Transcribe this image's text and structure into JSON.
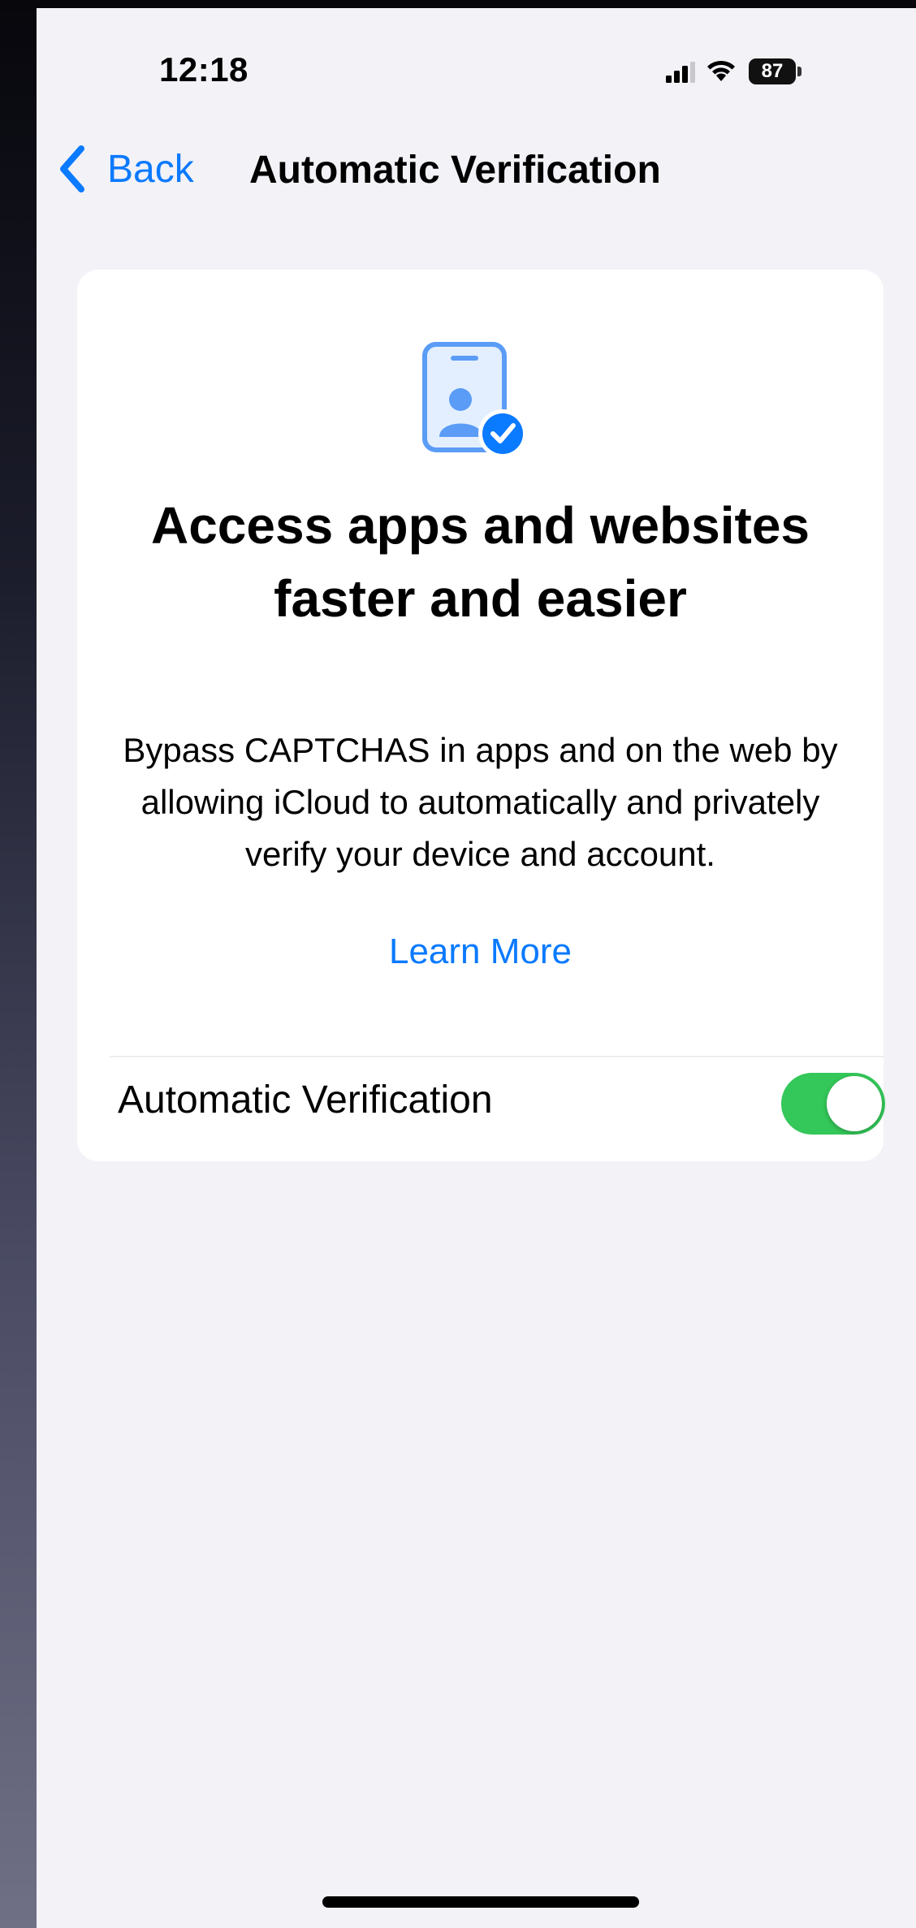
{
  "status_bar": {
    "time": "12:18",
    "battery_level": "87",
    "signal_icon": "cellular-signal-icon",
    "wifi_icon": "wifi-icon"
  },
  "nav": {
    "back_label": "Back",
    "title": "Automatic Verification",
    "back_icon": "chevron-left-icon"
  },
  "card": {
    "icon": "person-badge-checkmark-icon",
    "headline": "Access apps and websites faster and easier",
    "description": "Bypass CAPTCHAS in apps and on the web by allowing iCloud to automatically and privately verify your device and account.",
    "learn_more": "Learn More",
    "toggle_label": "Automatic Verification",
    "toggle_on": true
  },
  "colors": {
    "accent": "#0a7aff",
    "toggle_on": "#34c759",
    "background": "#f2f2f7",
    "card": "#ffffff"
  }
}
